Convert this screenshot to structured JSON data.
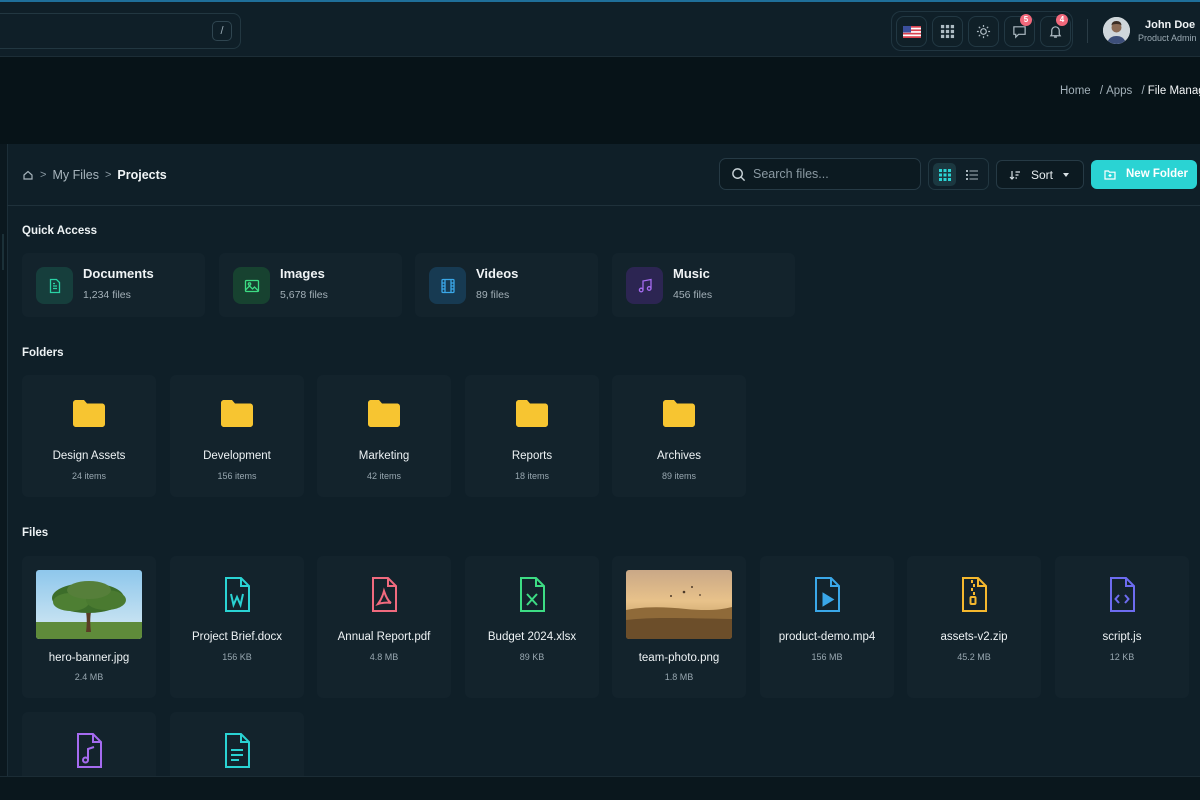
{
  "topbar": {
    "search_shortcut": "/",
    "user": {
      "name": "John Doe",
      "role": "Product Admin"
    },
    "notifications": {
      "messages_count": "5",
      "alerts_count": "4"
    }
  },
  "page_breadcrumb": [
    {
      "label": "Home"
    },
    {
      "label": "Apps"
    },
    {
      "label": "File Manager"
    }
  ],
  "toolbar": {
    "path": [
      "My Files",
      "Projects"
    ],
    "search_placeholder": "Search files...",
    "sort_label": "Sort",
    "new_folder_label": "New Folder"
  },
  "quick_access": {
    "title": "Quick Access",
    "items": [
      {
        "name": "Documents",
        "count": "1,234 files",
        "icon": "document-icon",
        "color": "#2ad3a5"
      },
      {
        "name": "Images",
        "count": "5,678 files",
        "icon": "image-icon",
        "color": "#3ddc84"
      },
      {
        "name": "Videos",
        "count": "89 files",
        "icon": "film-icon",
        "color": "#3aa7e8"
      },
      {
        "name": "Music",
        "count": "456 files",
        "icon": "music-icon",
        "color": "#a56bf0"
      }
    ]
  },
  "folders": {
    "title": "Folders",
    "items": [
      {
        "name": "Design Assets",
        "count": "24 items"
      },
      {
        "name": "Development",
        "count": "156 items"
      },
      {
        "name": "Marketing",
        "count": "42 items"
      },
      {
        "name": "Reports",
        "count": "18 items"
      },
      {
        "name": "Archives",
        "count": "89 items"
      }
    ]
  },
  "files": {
    "title": "Files",
    "items": [
      {
        "name": "hero-banner.jpg",
        "size": "2.4 MB",
        "kind": "image"
      },
      {
        "name": "Project Brief.docx",
        "size": "156 KB",
        "kind": "word",
        "color": "#2ad3d3"
      },
      {
        "name": "Annual Report.pdf",
        "size": "4.8 MB",
        "kind": "pdf",
        "color": "#f06a7e"
      },
      {
        "name": "Budget 2024.xlsx",
        "size": "89 KB",
        "kind": "excel",
        "color": "#3ddc84"
      },
      {
        "name": "team-photo.png",
        "size": "1.8 MB",
        "kind": "image"
      },
      {
        "name": "product-demo.mp4",
        "size": "156 MB",
        "kind": "video",
        "color": "#3aa7e8"
      },
      {
        "name": "assets-v2.zip",
        "size": "45.2 MB",
        "kind": "zip",
        "color": "#f5b82e"
      },
      {
        "name": "script.js",
        "size": "12 KB",
        "kind": "code",
        "color": "#6d6cf0"
      },
      {
        "name": "",
        "size": "",
        "kind": "audio",
        "color": "#a56bf0"
      },
      {
        "name": "",
        "size": "",
        "kind": "text",
        "color": "#2ad3d3"
      }
    ]
  },
  "colors": {
    "accent": "#2ad3d3",
    "folder": "#f7c531",
    "background": "#0c1a22",
    "card": "#13232c"
  }
}
